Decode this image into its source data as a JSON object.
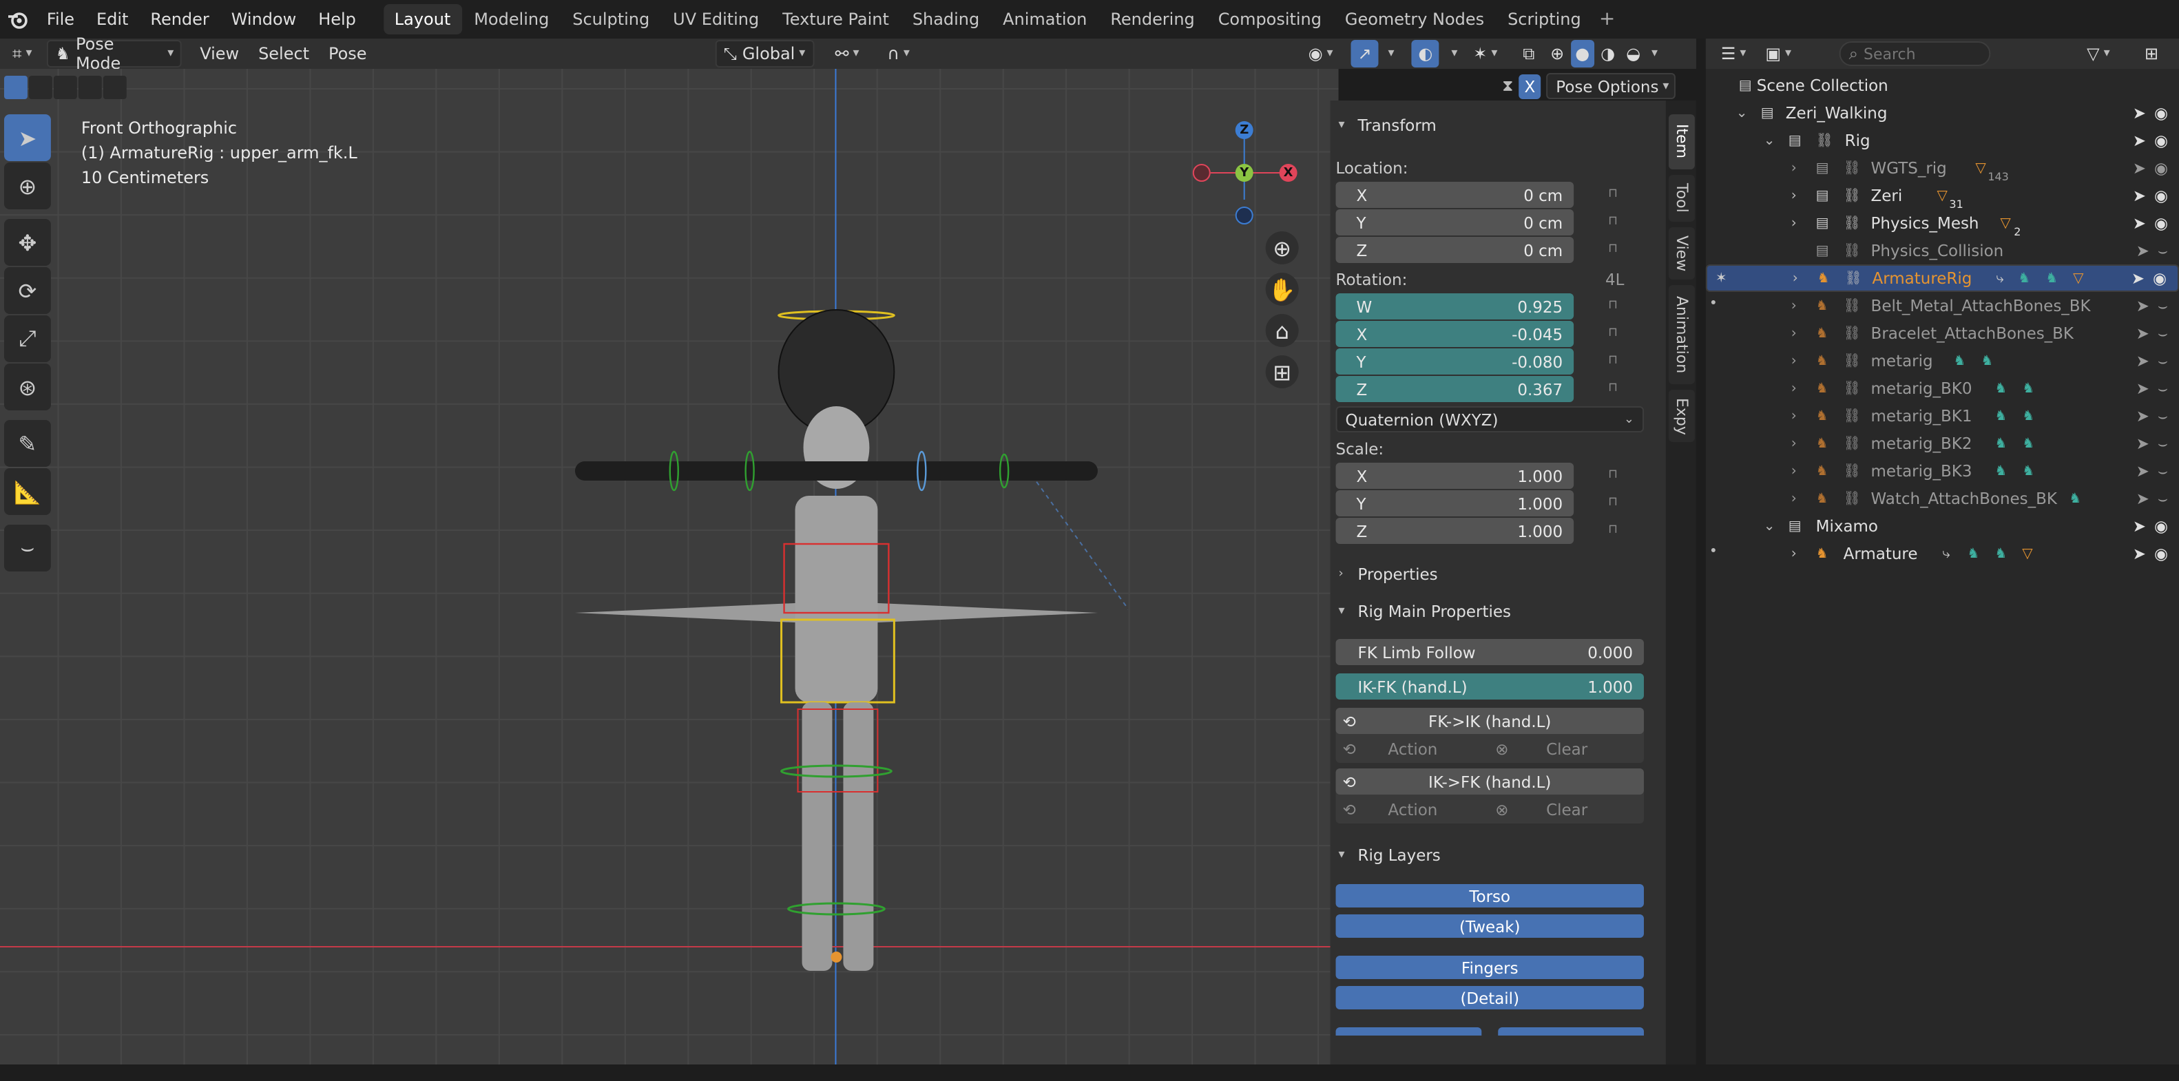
{
  "colors": {
    "accent": "#4772b3",
    "teal": "#3e8080",
    "orange": "#e69430",
    "axis_x": "#e0455a",
    "axis_y": "#8bc443",
    "axis_z": "#3c7dd3"
  },
  "menubar": {
    "menus": [
      "File",
      "Edit",
      "Render",
      "Window",
      "Help"
    ],
    "workspaces": [
      "Layout",
      "Modeling",
      "Sculpting",
      "UV Editing",
      "Texture Paint",
      "Shading",
      "Animation",
      "Rendering",
      "Compositing",
      "Geometry Nodes",
      "Scripting"
    ],
    "add_symbol": "+"
  },
  "viewport_header": {
    "mode": "Pose Mode",
    "menus": [
      "View",
      "Select",
      "Pose"
    ],
    "orientation": "Global"
  },
  "viewport": {
    "view_name": "Front Orthographic",
    "active": "(1) ArmatureRig : upper_arm_fk.L",
    "scale": "10 Centimeters",
    "gizmo": {
      "z": "Z",
      "y": "Y",
      "x": "X"
    },
    "pose_options": "Pose Options",
    "x_toggle": "X"
  },
  "npanel": {
    "tabs": [
      "Item",
      "Tool",
      "View",
      "Animation",
      "Expy"
    ],
    "transform": {
      "title": "Transform",
      "location_label": "Location:",
      "location": [
        {
          "axis": "X",
          "value": "0 cm"
        },
        {
          "axis": "Y",
          "value": "0 cm"
        },
        {
          "axis": "Z",
          "value": "0 cm"
        }
      ],
      "rotation_label": "Rotation:",
      "rotation_flag": "4L",
      "rotation": [
        {
          "axis": "W",
          "value": "0.925"
        },
        {
          "axis": "X",
          "value": "-0.045"
        },
        {
          "axis": "Y",
          "value": "-0.080"
        },
        {
          "axis": "Z",
          "value": "0.367"
        }
      ],
      "rotation_mode": "Quaternion (WXYZ)",
      "scale_label": "Scale:",
      "scale": [
        {
          "axis": "X",
          "value": "1.000"
        },
        {
          "axis": "Y",
          "value": "1.000"
        },
        {
          "axis": "Z",
          "value": "1.000"
        }
      ]
    },
    "properties_title": "Properties",
    "rig_main": {
      "title": "Rig Main Properties",
      "fk_limb_follow": {
        "label": "FK Limb Follow",
        "value": "0.000"
      },
      "ik_fk": {
        "label": "IK-FK (hand.L)",
        "value": "1.000"
      },
      "fk_to_ik": {
        "label": "FK->IK (hand.L)",
        "action": "Action",
        "clear": "Clear"
      },
      "ik_to_fk": {
        "label": "IK->FK (hand.L)",
        "action": "Action",
        "clear": "Clear"
      }
    },
    "rig_layers": {
      "title": "Rig Layers",
      "buttons": [
        "Torso",
        "(Tweak)",
        "Fingers",
        "(Detail)"
      ]
    }
  },
  "outliner": {
    "search_placeholder": "Search",
    "rows": [
      {
        "label": "Scene Collection",
        "indent": 0
      },
      {
        "label": "Zeri_Walking",
        "indent": 1
      },
      {
        "label": "Rig",
        "indent": 2
      },
      {
        "label": "WGTS_rig",
        "indent": 3,
        "badge": "143"
      },
      {
        "label": "Zeri",
        "indent": 3,
        "badge": "31"
      },
      {
        "label": "Physics_Mesh",
        "indent": 3,
        "badge": "2"
      },
      {
        "label": "Physics_Collision",
        "indent": 3
      },
      {
        "label": "ArmatureRig",
        "indent": 3,
        "selected": true
      },
      {
        "label": "Belt_Metal_AttachBones_BK",
        "indent": 3
      },
      {
        "label": "Bracelet_AttachBones_BK",
        "indent": 3
      },
      {
        "label": "metarig",
        "indent": 3
      },
      {
        "label": "metarig_BK0",
        "indent": 3
      },
      {
        "label": "metarig_BK1",
        "indent": 3
      },
      {
        "label": "metarig_BK2",
        "indent": 3
      },
      {
        "label": "metarig_BK3",
        "indent": 3
      },
      {
        "label": "Watch_AttachBones_BK",
        "indent": 3
      },
      {
        "label": "Mixamo",
        "indent": 2
      },
      {
        "label": "Armature",
        "indent": 3
      }
    ]
  }
}
